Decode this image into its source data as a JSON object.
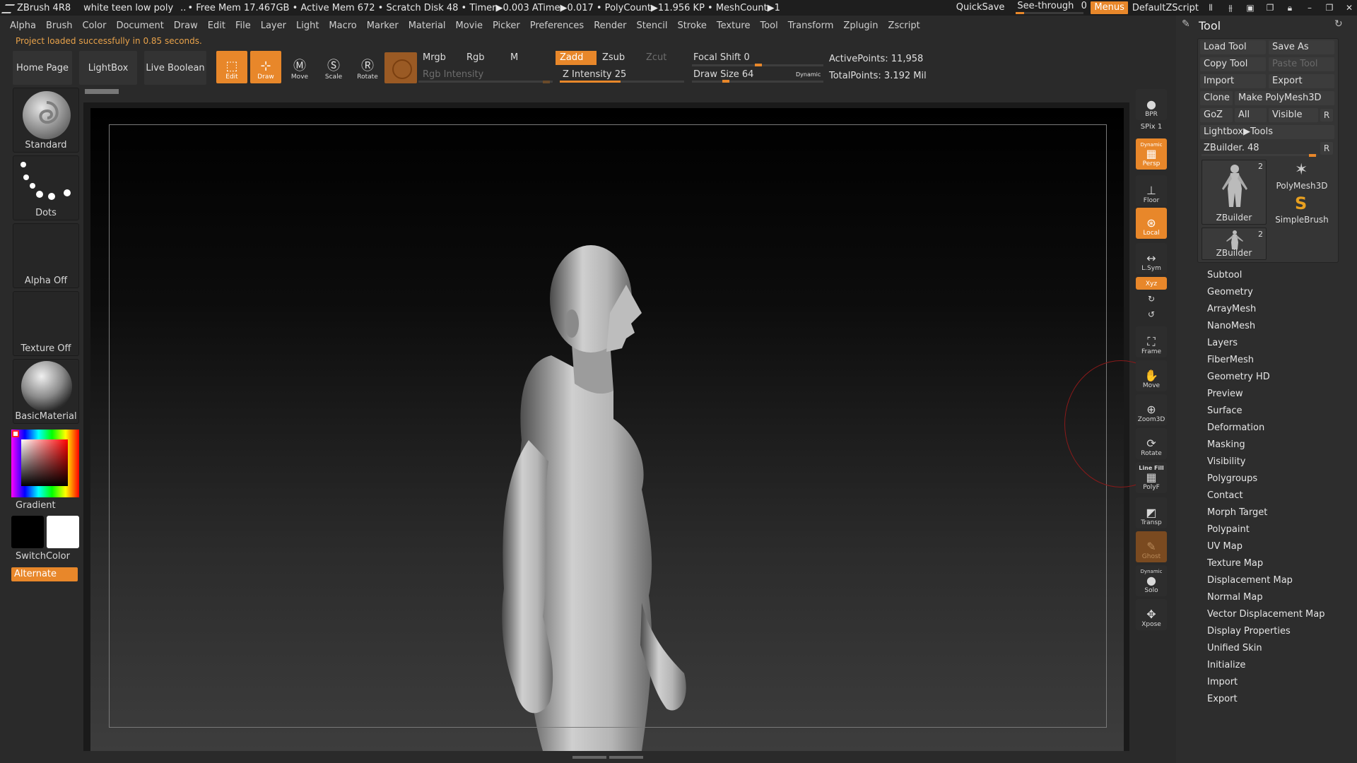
{
  "titlebar": {
    "app": "ZBrush 4R8",
    "project": "white teen low poly",
    "dots": "..",
    "stats": "• Free Mem 17.467GB • Active Mem 672 • Scratch Disk 48 •  Timer▶0.003 ATime▶0.017 • PolyCount▶11.956 KP  • MeshCount▶1",
    "quicksave": "QuickSave",
    "seethrough_label": "See-through",
    "seethrough_value": "0",
    "menus": "Menus",
    "zscript": "DefaultZScript"
  },
  "menubar": [
    "Alpha",
    "Brush",
    "Color",
    "Document",
    "Draw",
    "Edit",
    "File",
    "Layer",
    "Light",
    "Macro",
    "Marker",
    "Material",
    "Movie",
    "Picker",
    "Preferences",
    "Render",
    "Stencil",
    "Stroke",
    "Texture",
    "Tool",
    "Transform",
    "Zplugin",
    "Zscript"
  ],
  "status_message": "Project loaded successfully in 0.85 seconds.",
  "shelf": {
    "home": "Home Page",
    "lightbox": "LightBox",
    "live_boolean": "Live Boolean",
    "edit": "Edit",
    "draw": "Draw",
    "move": "Move",
    "scale": "Scale",
    "rotate": "Rotate",
    "mrgb": "Mrgb",
    "rgb": "Rgb",
    "m": "M",
    "zadd": "Zadd",
    "zsub": "Zsub",
    "zcut": "Zcut",
    "rgb_intensity": "Rgb Intensity",
    "z_intensity": "Z Intensity 25",
    "focal_shift": "Focal Shift 0",
    "draw_size": "Draw Size 64",
    "dynamic": "Dynamic",
    "active_points": "ActivePoints: 11,958",
    "total_points": "TotalPoints: 3.192 Mil"
  },
  "left": {
    "brush": "Standard",
    "stroke": "Dots",
    "alpha": "Alpha Off",
    "texture": "Texture Off",
    "material": "BasicMaterial",
    "gradient": "Gradient",
    "switchcolor": "SwitchColor",
    "alternate": "Alternate"
  },
  "right_dock": {
    "bpr": "BPR",
    "spix": "SPix 1",
    "dynamic": "Dynamic",
    "persp": "Persp",
    "floor": "Floor",
    "local": "Local",
    "lsym": "L.Sym",
    "xyz": "Xyz",
    "frame": "Frame",
    "move": "Move",
    "zoom3d": "Zoom3D",
    "rotate": "Rotate",
    "linefill": "Line Fill",
    "polyf": "PolyF",
    "transp": "Transp",
    "ghost": "Ghost",
    "dynamic2": "Dynamic",
    "solo": "Solo",
    "xpose": "Xpose"
  },
  "tool": {
    "title": "Tool",
    "load_tool": "Load Tool",
    "save_as": "Save As",
    "copy_tool": "Copy Tool",
    "paste_tool": "Paste Tool",
    "import": "Import",
    "export": "Export",
    "clone": "Clone",
    "make_polymesh": "Make PolyMesh3D",
    "goz": "GoZ",
    "all": "All",
    "visible": "Visible",
    "r": "R",
    "lightbox_tools": "Lightbox▶Tools",
    "zbuilder": "ZBuilder. 48",
    "thumbs": [
      {
        "label": "ZBuilder",
        "count": "2"
      },
      {
        "label": "PolyMesh3D",
        "count": ""
      },
      {
        "label": "SimpleBrush",
        "count": ""
      },
      {
        "label": "ZBuilder",
        "count": "2"
      }
    ],
    "sections": [
      "Subtool",
      "Geometry",
      "ArrayMesh",
      "NanoMesh",
      "Layers",
      "FiberMesh",
      "Geometry HD",
      "Preview",
      "Surface",
      "Deformation",
      "Masking",
      "Visibility",
      "Polygroups",
      "Contact",
      "Morph Target",
      "Polypaint",
      "UV Map",
      "Texture Map",
      "Displacement Map",
      "Normal Map",
      "Vector Displacement Map",
      "Display Properties",
      "Unified Skin",
      "Initialize",
      "Import",
      "Export"
    ]
  },
  "colors": {
    "accent": "#e8872a",
    "background": "#2a2a2a"
  }
}
